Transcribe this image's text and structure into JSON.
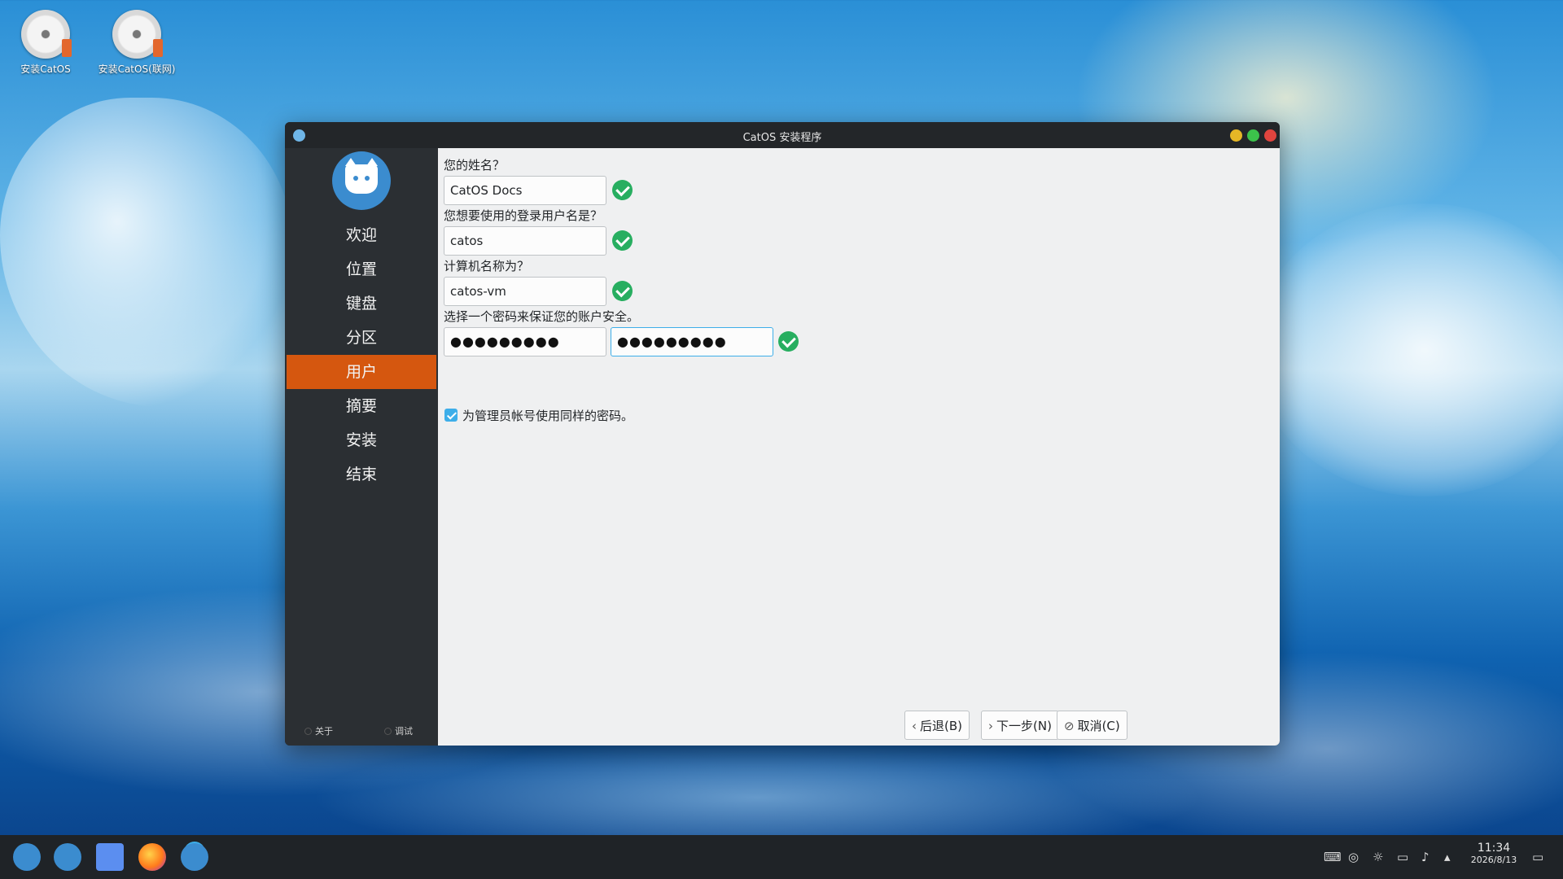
{
  "desktop": {
    "icons": [
      {
        "label": "安装CatOS",
        "icon": "disc-usb-icon"
      },
      {
        "label": "安装CatOS(联网)",
        "icon": "disc-usb-icon"
      }
    ]
  },
  "window": {
    "title": "CatOS 安装程序",
    "sidebar": {
      "items": [
        {
          "label": "欢迎"
        },
        {
          "label": "位置"
        },
        {
          "label": "键盘"
        },
        {
          "label": "分区"
        },
        {
          "label": "用户",
          "active": true
        },
        {
          "label": "摘要"
        },
        {
          "label": "安装"
        },
        {
          "label": "结束"
        }
      ],
      "footer": {
        "about": "关于",
        "debug": "调试"
      }
    },
    "form": {
      "name_label": "您的姓名？",
      "name_value": "CatOS Docs",
      "login_label": "您想要使用的登录用户名是？",
      "login_value": "catos",
      "hostname_label": "计算机名称为？",
      "hostname_value": "catos-vm",
      "password_label": "选择一个密码来保证您的账户安全。",
      "password_value": "●●●●●●●●●",
      "password_repeat_value": "●●●●●●●●●",
      "admin_same_password_label": "为管理员帐号使用同样的密码。",
      "admin_same_password_checked": true
    },
    "buttons": {
      "back": "后退(B)",
      "next": "下一步(N)",
      "cancel": "取消(C)"
    }
  },
  "taskbar": {
    "apps": [
      "catos-icon",
      "toggle-icon",
      "folder-icon",
      "firefox-icon",
      "catos-installer-icon"
    ],
    "tray": [
      "keyboard-icon",
      "network-icon",
      "brightness-icon",
      "display-icon",
      "volume-icon",
      "chevron-up-icon"
    ],
    "time": "11:34",
    "date": "2026/8/13"
  },
  "colors": {
    "accent": "#d5570f",
    "sidebar_bg": "#2b2f33",
    "content_bg": "#eff0f1",
    "check_green": "#27ae60",
    "focus_blue": "#3daee9"
  }
}
